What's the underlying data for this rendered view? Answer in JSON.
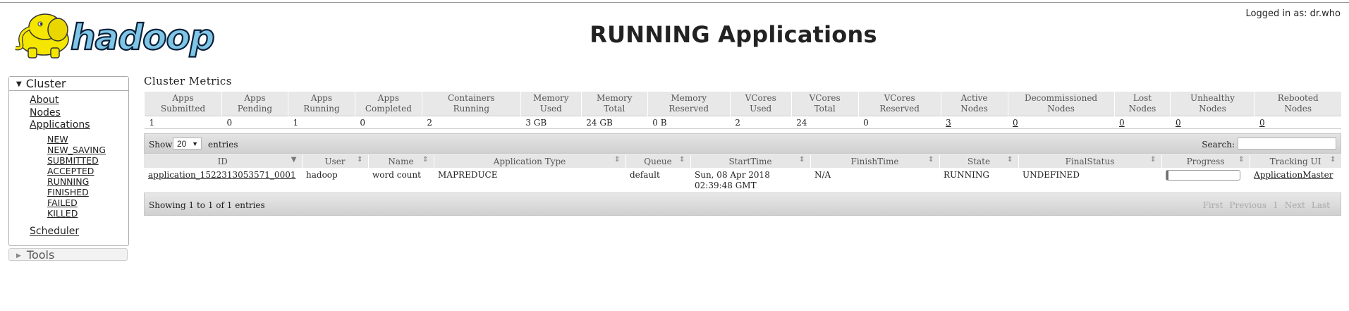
{
  "header": {
    "logo_text": "hadoop",
    "logged_in": "Logged in as: dr.who",
    "page_title": "RUNNING Applications"
  },
  "sidebar": {
    "cluster_label": "Cluster",
    "links": [
      "About",
      "Nodes",
      "Applications"
    ],
    "app_states": [
      "NEW",
      "NEW_SAVING",
      "SUBMITTED",
      "ACCEPTED",
      "RUNNING",
      "FINISHED",
      "FAILED",
      "KILLED"
    ],
    "scheduler": "Scheduler",
    "tools_label": "Tools"
  },
  "metrics": {
    "title": "Cluster Metrics",
    "headers": [
      [
        "Apps",
        "Submitted"
      ],
      [
        "Apps",
        "Pending"
      ],
      [
        "Apps",
        "Running"
      ],
      [
        "Apps",
        "Completed"
      ],
      [
        "Containers",
        "Running"
      ],
      [
        "Memory",
        "Used"
      ],
      [
        "Memory",
        "Total"
      ],
      [
        "Memory",
        "Reserved"
      ],
      [
        "VCores",
        "Used"
      ],
      [
        "VCores",
        "Total"
      ],
      [
        "VCores",
        "Reserved"
      ],
      [
        "Active",
        "Nodes"
      ],
      [
        "Decommissioned",
        "Nodes"
      ],
      [
        "Lost",
        "Nodes"
      ],
      [
        "Unhealthy",
        "Nodes"
      ],
      [
        "Rebooted",
        "Nodes"
      ]
    ],
    "values": [
      "1",
      "0",
      "1",
      "0",
      "2",
      "3 GB",
      "24 GB",
      "0 B",
      "2",
      "24",
      "0",
      "3",
      "0",
      "0",
      "0",
      "0"
    ]
  },
  "apps_table": {
    "show_label": "Show",
    "page_length": "20",
    "entries_label": "entries",
    "search_label": "Search:",
    "search_value": "",
    "columns": [
      "ID",
      "User",
      "Name",
      "Application Type",
      "Queue",
      "StartTime",
      "FinishTime",
      "State",
      "FinalStatus",
      "Progress",
      "Tracking UI"
    ],
    "rows": [
      {
        "id": "application_1522313053571_0001",
        "user": "hadoop",
        "name": "word count",
        "type": "MAPREDUCE",
        "queue": "default",
        "start_time": "Sun, 08 Apr 2018 02:39:48 GMT",
        "finish_time": "N/A",
        "state": "RUNNING",
        "final_status": "UNDEFINED",
        "progress_fraction": 0.03,
        "tracking_ui": "ApplicationMaster"
      }
    ],
    "info": "Showing 1 to 1 of 1 entries",
    "pager": [
      "First",
      "Previous",
      "1",
      "Next",
      "Last"
    ]
  }
}
